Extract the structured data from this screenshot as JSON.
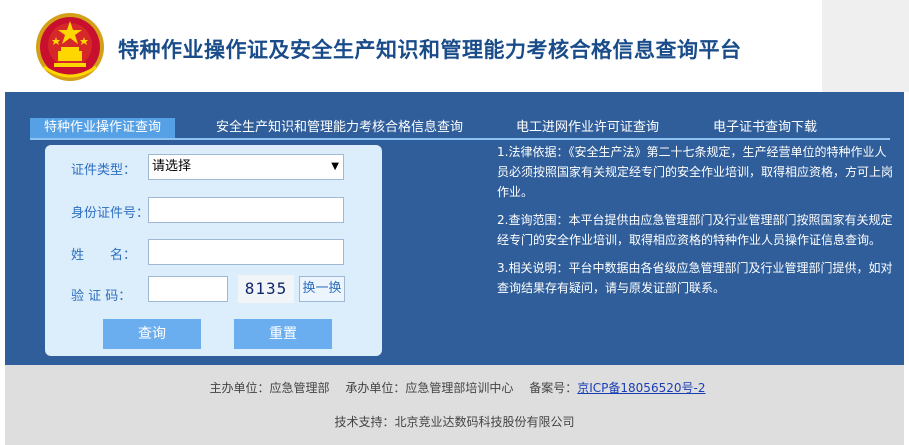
{
  "header": {
    "title": "特种作业操作证及安全生产知识和管理能力考核合格信息查询平台",
    "emblem_icon": "national-emblem-icon"
  },
  "tabs": [
    {
      "label": "特种作业操作证查询",
      "active": true
    },
    {
      "label": "安全生产知识和管理能力考核合格信息查询",
      "active": false
    },
    {
      "label": "电工进网作业许可证查询",
      "active": false
    },
    {
      "label": "电子证书查询下载",
      "active": false
    }
  ],
  "form": {
    "cert_type_label": "证件类型：",
    "cert_type_value": "请选择",
    "id_label": "身份证件号：",
    "id_value": "",
    "name_label": "姓　　名：",
    "name_value": "",
    "captcha_label": "验 证 码：",
    "captcha_value": "",
    "captcha_text": "8135",
    "refresh_label": "换一换",
    "query_button": "查询",
    "reset_button": "重置"
  },
  "info": [
    "1.法律依据：《安全生产法》第二十七条规定，生产经营单位的特种作业人员必须按照国家有关规定经专门的安全作业培训，取得相应资格，方可上岗作业。",
    "2.查询范围：本平台提供由应急管理部门及行业管理部门按照国家有关规定经专门的安全作业培训，取得相应资格的特种作业人员操作证信息查询。",
    "3.相关说明：平台中数据由各省级应急管理部门及行业管理部门提供，如对查询结果存有疑问，请与原发证部门联系。"
  ],
  "footer": {
    "organizer": "主办单位：应急管理部",
    "undertaker": "承办单位：应急管理部培训中心",
    "icp_label": "备案号：",
    "icp_link": "京ICP备18056520号-2",
    "support": "技术支持：北京竞业达数码科技股份有限公司"
  },
  "colors": {
    "primary_blue": "#2f5e9b",
    "tab_active": "#56a0e6",
    "form_bg": "#dcedfb",
    "button": "#6aaef0",
    "footer_bg": "#dedede"
  }
}
